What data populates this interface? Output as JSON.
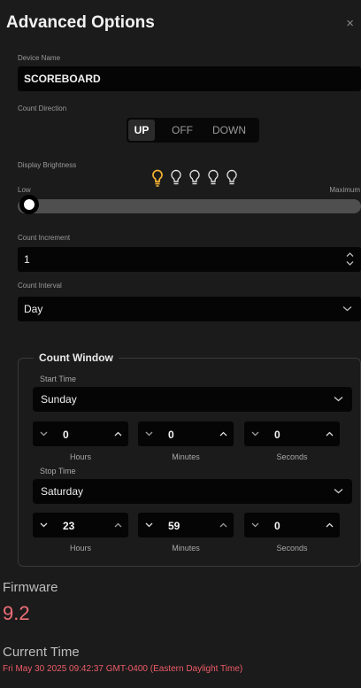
{
  "dialog": {
    "title": "Advanced Options",
    "close_symbol": "×"
  },
  "device_name": {
    "label": "Device Name",
    "value": "SCOREBOARD"
  },
  "count_direction": {
    "label": "Count Direction",
    "options": [
      "UP",
      "OFF",
      "DOWN"
    ],
    "selected": "UP"
  },
  "display_brightness": {
    "label": "Display Brightness",
    "min_label": "Low",
    "max_label": "Maximum",
    "level": 1,
    "levels_total": 5,
    "slider_value_fraction": 0,
    "active_color": "#f2b233",
    "inactive_color": "#e0e0e0"
  },
  "count_increment": {
    "label": "Count Increment",
    "value": "1"
  },
  "count_interval": {
    "label": "Count Interval",
    "value": "Day"
  },
  "count_window": {
    "legend": "Count Window",
    "start": {
      "label": "Start Time",
      "day": "Sunday",
      "hours": "0",
      "minutes": "0",
      "seconds": "0"
    },
    "stop": {
      "label": "Stop Time",
      "day": "Saturday",
      "hours": "23",
      "minutes": "59",
      "seconds": "0"
    },
    "units": {
      "hours": "Hours",
      "minutes": "Minutes",
      "seconds": "Seconds"
    }
  },
  "firmware": {
    "label": "Firmware",
    "value": "9.2"
  },
  "current_time": {
    "label": "Current Time",
    "value": "Fri May 30 2025 09:42:37 GMT-0400 (Eastern Daylight Time)"
  },
  "colors": {
    "background": "#1b1b1b",
    "field": "#050505",
    "accent_red": "#ef6f78",
    "bulb_on": "#f2b233"
  }
}
